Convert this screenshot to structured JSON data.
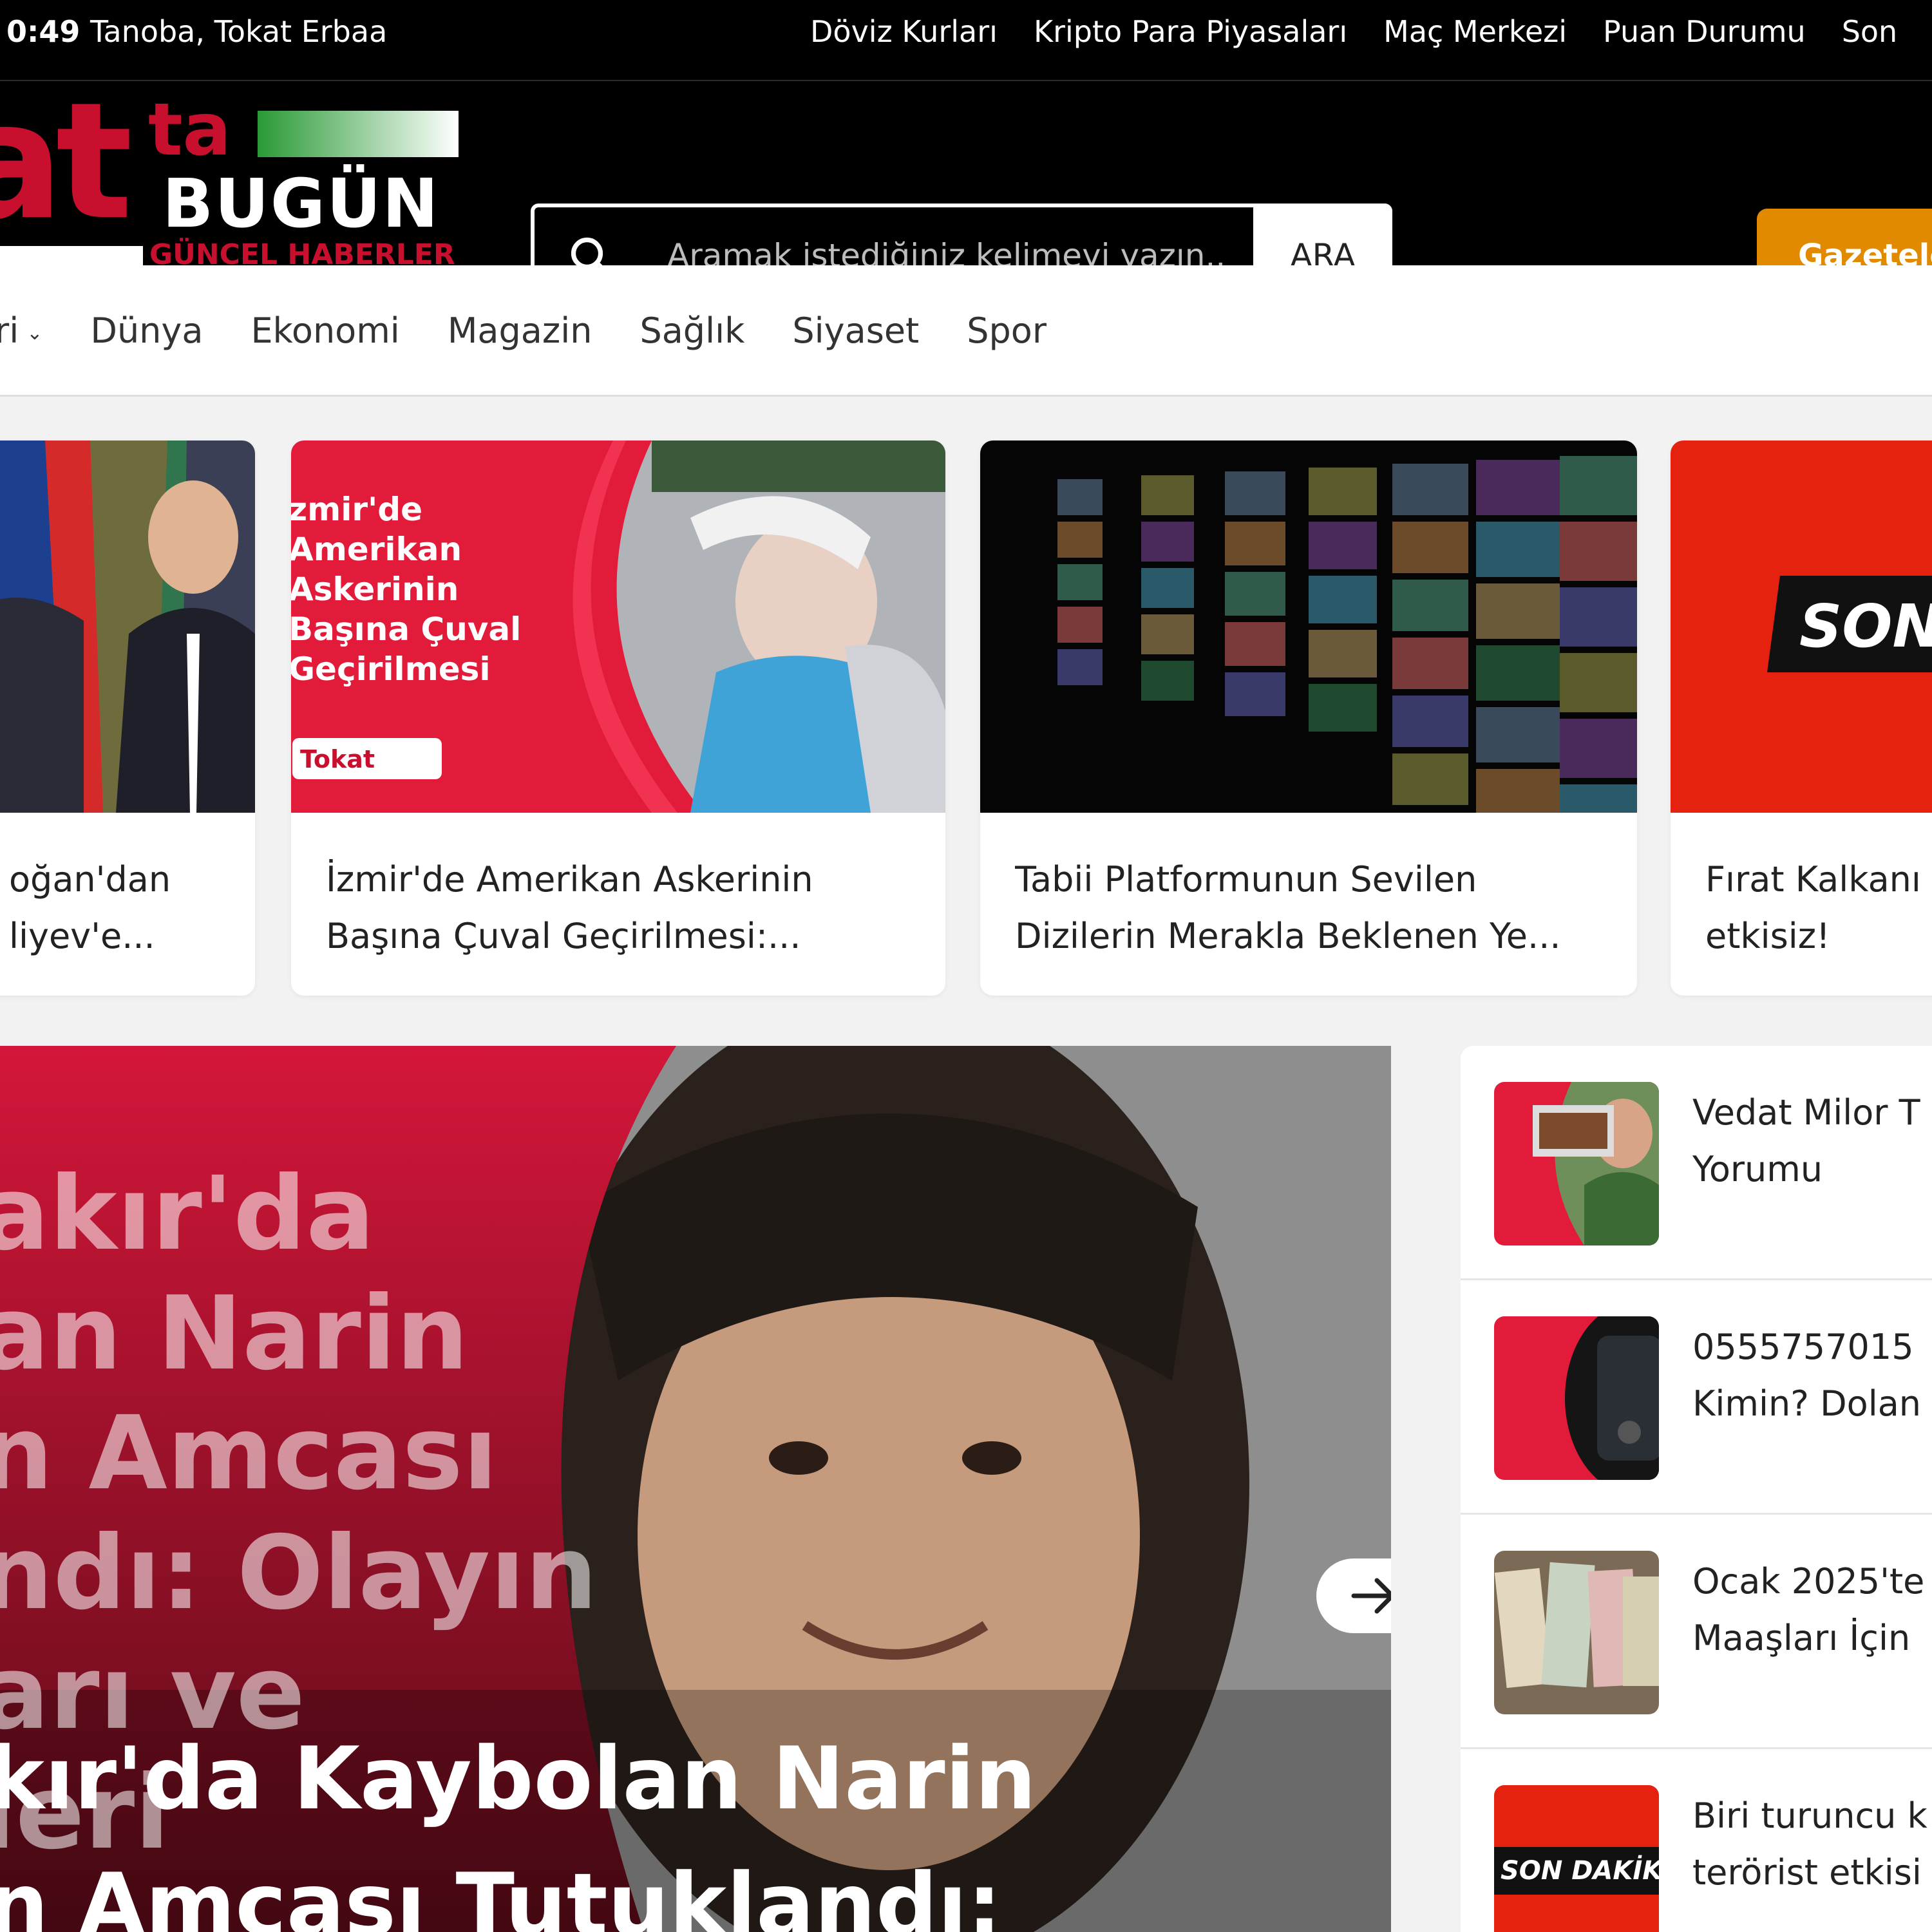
{
  "topbar": {
    "clock": "0:49",
    "location": "Tanoba, Tokat Erbaa",
    "links": [
      "Döviz Kurları",
      "Kripto Para Piyasaları",
      "Maç Merkezi",
      "Puan Durumu",
      "Son"
    ]
  },
  "logo": {
    "big": "at",
    "ta": "ta",
    "bugun": "BUGÜN",
    "tagline": "GÜNCEL HABERLER"
  },
  "search": {
    "placeholder": "Aramak istediğiniz kelimeyi yazın..",
    "button": "ARA"
  },
  "header": {
    "gazeteler": "Gazeteler"
  },
  "nav": {
    "items": [
      "ri",
      "Dünya",
      "Ekonomi",
      "Magazin",
      "Sağlık",
      "Siyaset",
      "Spor"
    ]
  },
  "cards": [
    {
      "title": "oğan'dan\nliyev'e..."
    },
    {
      "title": "İzmir'de Amerikan Askerinin\nBaşına Çuval Geçirilmesi:...",
      "overlay": "zmir'de\nAmerikan\nAskerinin\nBaşına Çuval\nGeçirilmesi",
      "badge": "Tokat"
    },
    {
      "title": "Tabii Platformunun Sevilen\nDizilerin Merakla Beklenen Ye..."
    },
    {
      "title": "Fırat Kalkanı\netkisiz!",
      "badge": "SON"
    }
  ],
  "hero": {
    "overlay": "akır'da\nan Narin\nn Amcası\nndı: Olayın\narı ve\nleri",
    "headline": "kır'da Kaybolan Narin\nn Amcası Tutuklandı:"
  },
  "sidebar": [
    {
      "title": "Vedat Milor T\nYorumu"
    },
    {
      "title": "0555757015\nKimin? Dolan"
    },
    {
      "title": "Ocak 2025'te\nMaaşları İçin"
    },
    {
      "title": "Biri turuncu k\nterörist etkisi",
      "badge": "SON DAKİKA"
    }
  ],
  "colors": {
    "brand_red": "#c8102e",
    "accent_orange": "#e18a00",
    "topbar": "#000000"
  },
  "icons": {
    "search": "search-icon",
    "next": "arrow-right-icon"
  }
}
